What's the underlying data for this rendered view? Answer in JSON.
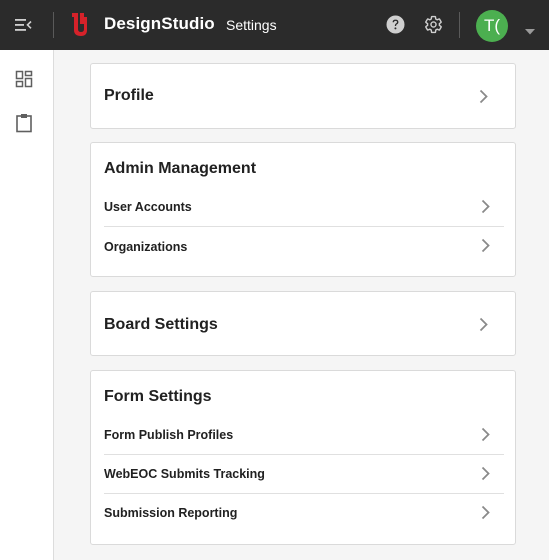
{
  "header": {
    "app_name": "DesignStudio",
    "page_name": "Settings",
    "avatar_initials": "T("
  },
  "colors": {
    "topbar": "#2b2b2b",
    "brand_red": "#d6222a",
    "avatar_green": "#4caf50"
  },
  "sidenav": {
    "items": [
      {
        "icon": "dashboard-icon"
      },
      {
        "icon": "clipboard-icon"
      }
    ]
  },
  "cards": {
    "profile": {
      "title": "Profile"
    },
    "admin": {
      "title": "Admin Management",
      "items": [
        "User Accounts",
        "Organizations"
      ]
    },
    "board": {
      "title": "Board Settings"
    },
    "forms": {
      "title": "Form Settings",
      "items": [
        "Form Publish Profiles",
        "WebEOC Submits Tracking",
        "Submission Reporting"
      ]
    }
  }
}
